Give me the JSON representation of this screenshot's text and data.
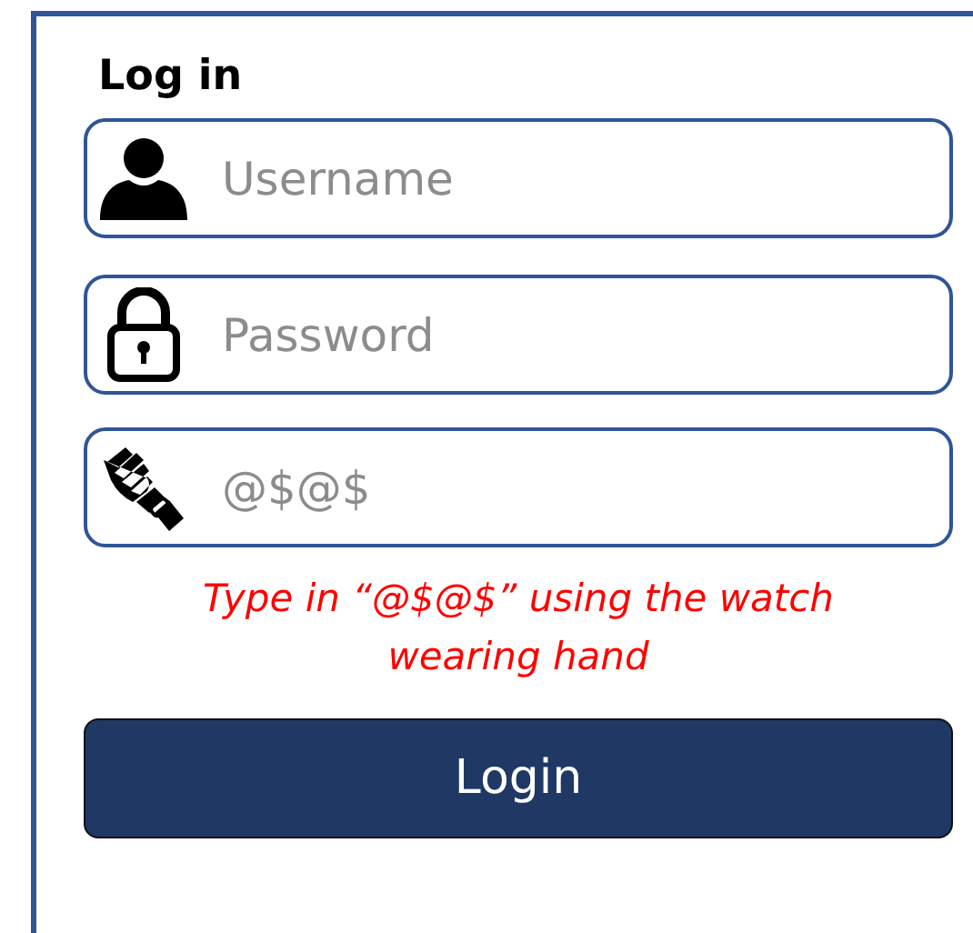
{
  "title": "Log in",
  "fields": [
    {
      "kind": "person",
      "placeholder": "Username"
    },
    {
      "kind": "lock",
      "placeholder": "Password"
    },
    {
      "kind": "hand",
      "placeholder": "@$@$"
    }
  ],
  "hint": "Type in “@$@$” using the watch wearing hand",
  "button": "Login"
}
